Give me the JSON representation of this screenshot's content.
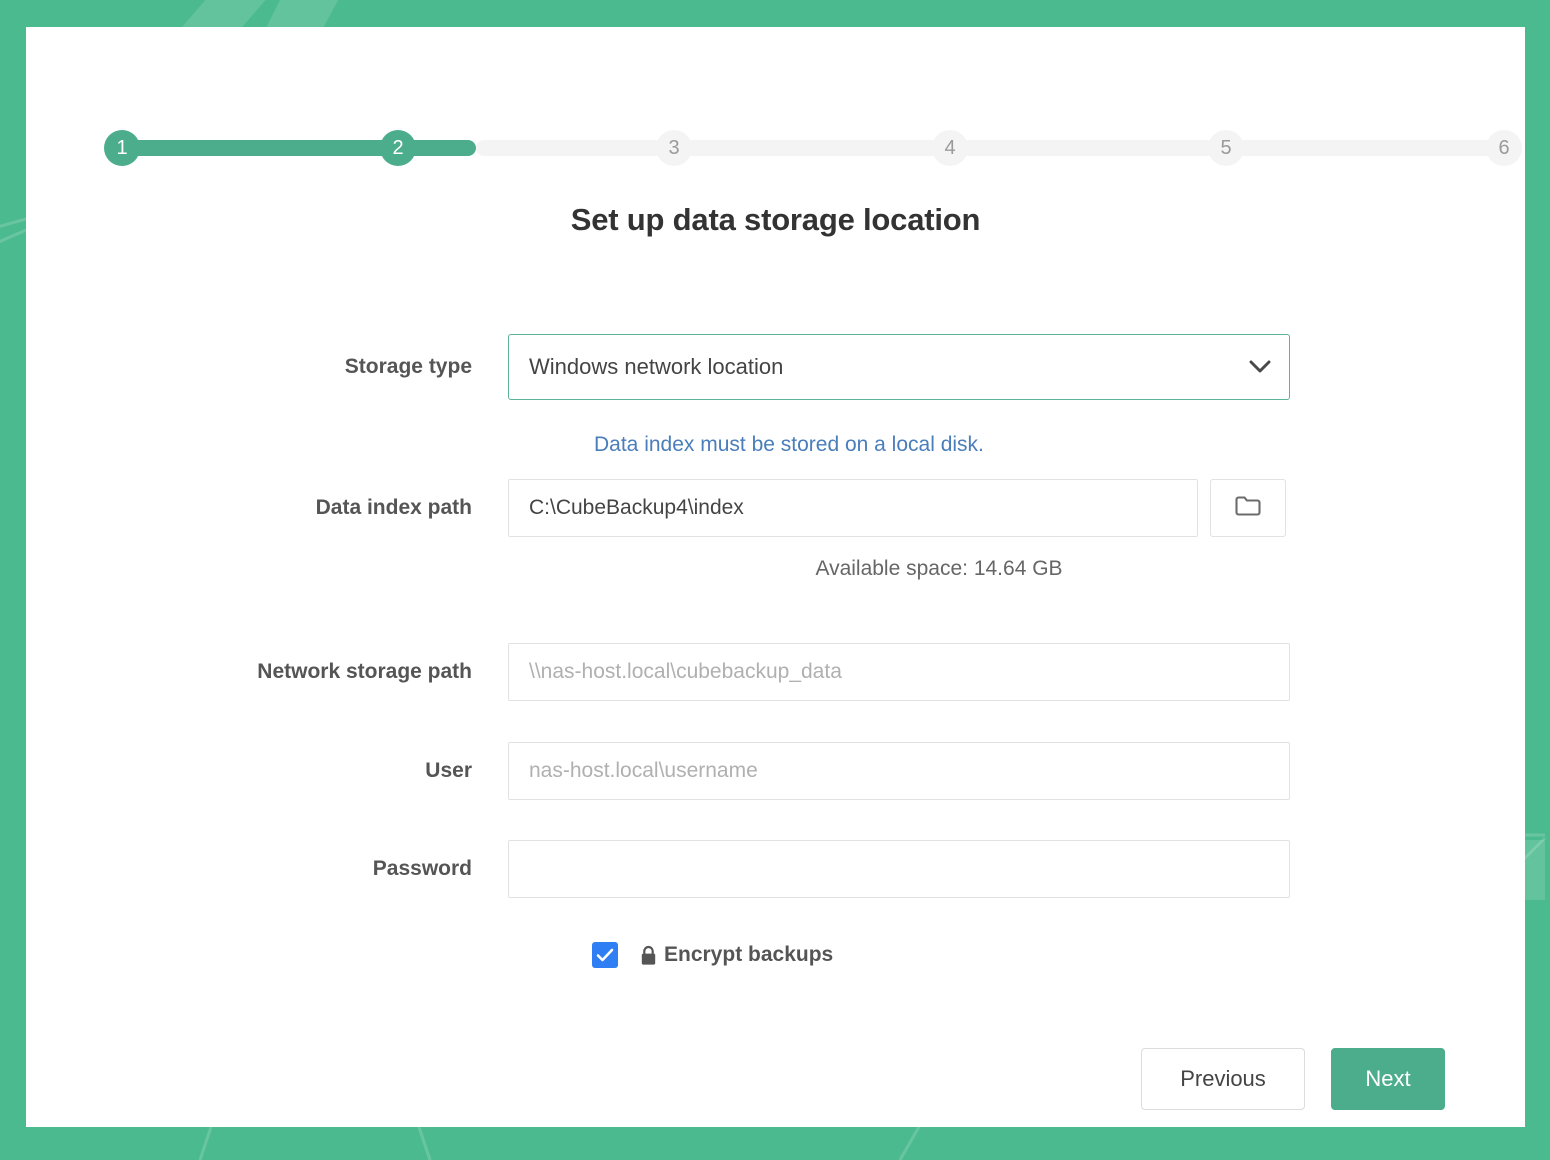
{
  "theme": {
    "accent": "#4cad8d",
    "background": "#4cba8f",
    "link": "#4a7ebb",
    "checkbox": "#2f7ef3",
    "track_inactive": "#f4f4f4"
  },
  "stepper": {
    "current": 2,
    "total": 6,
    "steps": [
      {
        "number": "1",
        "state": "done"
      },
      {
        "number": "2",
        "state": "done"
      },
      {
        "number": "3",
        "state": "todo"
      },
      {
        "number": "4",
        "state": "todo"
      },
      {
        "number": "5",
        "state": "todo"
      },
      {
        "number": "6",
        "state": "todo"
      }
    ]
  },
  "page": {
    "title": "Set up data storage location"
  },
  "form": {
    "storage_type": {
      "label": "Storage type",
      "value": "Windows network location",
      "icon": "chevron-down-icon"
    },
    "index_hint": "Data index must be stored on a local disk.",
    "data_index_path": {
      "label": "Data index path",
      "value": "C:\\CubeBackup4\\index",
      "placeholder": "",
      "browse_icon": "folder-icon"
    },
    "available_space": "Available space: 14.64 GB",
    "network_storage_path": {
      "label": "Network storage path",
      "value": "",
      "placeholder": "\\\\nas-host.local\\cubebackup_data"
    },
    "user": {
      "label": "User",
      "value": "",
      "placeholder": "nas-host.local\\username"
    },
    "password": {
      "label": "Password",
      "value": "",
      "placeholder": ""
    },
    "encrypt_backups": {
      "label": "Encrypt backups",
      "checked": true,
      "icon": "lock-icon"
    }
  },
  "footer": {
    "previous_label": "Previous",
    "next_label": "Next"
  }
}
